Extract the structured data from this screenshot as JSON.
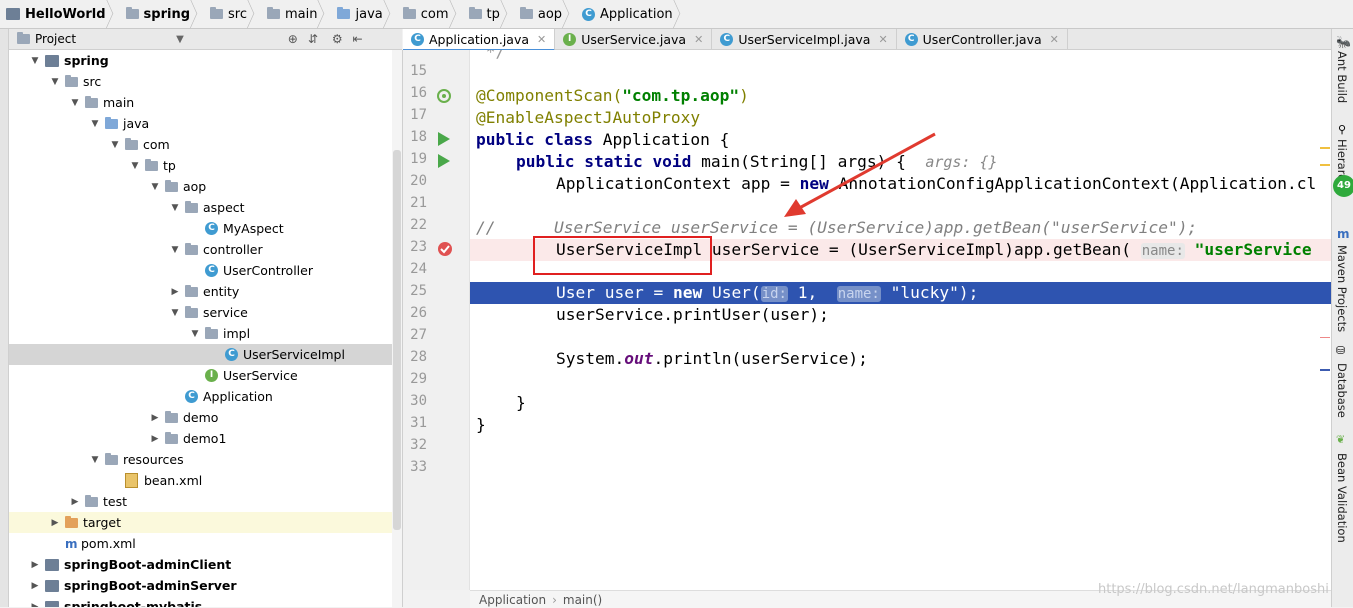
{
  "breadcrumb": [
    "HelloWorld",
    "spring",
    "src",
    "main",
    "java",
    "com",
    "tp",
    "aop",
    "Application"
  ],
  "project_panel": {
    "title": "Project",
    "icons": [
      "target-icon",
      "collapse-icon",
      "gear-icon",
      "hide-icon"
    ]
  },
  "tree": [
    {
      "label": "spring",
      "depth": 1,
      "arrow": "down",
      "icon": "module",
      "bold": true
    },
    {
      "label": "src",
      "depth": 2,
      "arrow": "down",
      "icon": "folder"
    },
    {
      "label": "main",
      "depth": 3,
      "arrow": "down",
      "icon": "folder"
    },
    {
      "label": "java",
      "depth": 4,
      "arrow": "down",
      "icon": "folder-blue"
    },
    {
      "label": "com",
      "depth": 5,
      "arrow": "down",
      "icon": "folder"
    },
    {
      "label": "tp",
      "depth": 6,
      "arrow": "down",
      "icon": "folder"
    },
    {
      "label": "aop",
      "depth": 7,
      "arrow": "down",
      "icon": "folder"
    },
    {
      "label": "aspect",
      "depth": 8,
      "arrow": "down",
      "icon": "folder"
    },
    {
      "label": "MyAspect",
      "depth": 9,
      "arrow": "",
      "icon": "class"
    },
    {
      "label": "controller",
      "depth": 8,
      "arrow": "down",
      "icon": "folder"
    },
    {
      "label": "UserController",
      "depth": 9,
      "arrow": "",
      "icon": "class"
    },
    {
      "label": "entity",
      "depth": 8,
      "arrow": "right",
      "icon": "folder"
    },
    {
      "label": "service",
      "depth": 8,
      "arrow": "down",
      "icon": "folder"
    },
    {
      "label": "impl",
      "depth": 9,
      "arrow": "down",
      "icon": "folder"
    },
    {
      "label": "UserServiceImpl",
      "depth": 10,
      "arrow": "",
      "icon": "class",
      "selected": true
    },
    {
      "label": "UserService",
      "depth": 9,
      "arrow": "",
      "icon": "interface"
    },
    {
      "label": "Application",
      "depth": 8,
      "arrow": "",
      "icon": "class"
    },
    {
      "label": "demo",
      "depth": 7,
      "arrow": "right",
      "icon": "folder"
    },
    {
      "label": "demo1",
      "depth": 7,
      "arrow": "right",
      "icon": "folder"
    },
    {
      "label": "resources",
      "depth": 4,
      "arrow": "down",
      "icon": "folder"
    },
    {
      "label": "bean.xml",
      "depth": 5,
      "arrow": "",
      "icon": "xml"
    },
    {
      "label": "test",
      "depth": 3,
      "arrow": "right",
      "icon": "folder"
    },
    {
      "label": "target",
      "depth": 2,
      "arrow": "right",
      "icon": "folder-orange",
      "highlight": true
    },
    {
      "label": "pom.xml",
      "depth": 2,
      "arrow": "",
      "icon": "maven"
    },
    {
      "label": "springBoot-adminClient",
      "depth": 1,
      "arrow": "right",
      "icon": "module",
      "bold": true
    },
    {
      "label": "springBoot-adminServer",
      "depth": 1,
      "arrow": "right",
      "icon": "module",
      "bold": true
    },
    {
      "label": "springboot-mybatis",
      "depth": 1,
      "arrow": "right",
      "icon": "module",
      "bold": true
    }
  ],
  "tabs": [
    {
      "label": "Application.java",
      "icon": "C",
      "active": true
    },
    {
      "label": "UserService.java",
      "icon": "I"
    },
    {
      "label": "UserServiceImpl.java",
      "icon": "C"
    },
    {
      "label": "UserController.java",
      "icon": "C"
    }
  ],
  "line_numbers": [
    "15",
    "16",
    "17",
    "18",
    "19",
    "20",
    "21",
    "22",
    "23",
    "24",
    "25",
    "26",
    "27",
    "28",
    "29",
    "30",
    "31",
    "32",
    "33"
  ],
  "code": {
    "l16_ann": "@ComponentScan(",
    "l16_str": "\"com.tp.aop\"",
    "l16_end": ")",
    "l17": "@EnableAspectJAutoProxy",
    "l18_kw": "public class",
    "l18_rest": " Application {",
    "l19_kw": "public static void",
    "l19_rest": " main(String[] args) {  ",
    "l19_hint": "args: {}",
    "l20_a": "ApplicationContext app = ",
    "l20_kw": "new",
    "l20_b": " AnnotationConfigApplicationContext(Application.cl",
    "l22": "//      UserService userService = (UserService)app.getBean(\"userService\");",
    "l23_type": "UserServiceImpl",
    "l23_rest": " userService = (UserServiceImpl)app.getBean( ",
    "l23_pname": "name:",
    "l23_str": " \"userService",
    "l25_a": "User user = ",
    "l25_kw": "new",
    "l25_b": " User(",
    "l25_p1": "id:",
    "l25_v1": " 1,  ",
    "l25_p2": "name:",
    "l25_v2": " \"lucky\");",
    "l26": "userService.printUser(user);",
    "l28_a": "System.",
    "l28_out": "out",
    "l28_b": ".println(userService);",
    "l30": "}",
    "l31": "}"
  },
  "right_tools": [
    "Ant Build",
    "Hierarchy",
    "Maven Projects",
    "Database",
    "Bean Validation"
  ],
  "right_badge": "49",
  "editor_breadcrumb": [
    "Application",
    "main()"
  ],
  "watermark": "https://blog.csdn.net/langmanboshi",
  "colors": {
    "selection": "#2e54b0",
    "error_box": "#e02020",
    "arrow": "#e03a2f",
    "keyword": "#000080",
    "string": "#008000"
  }
}
